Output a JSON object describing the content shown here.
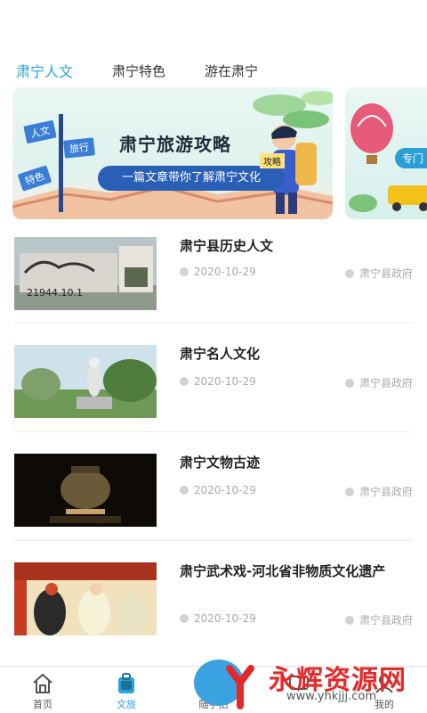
{
  "tabs": [
    {
      "label": "肃宁人文",
      "active": true
    },
    {
      "label": "肃宁特色",
      "active": false
    },
    {
      "label": "游在肃宁",
      "active": false
    }
  ],
  "banner": {
    "title": "肃宁旅游攻略",
    "subtitle": "一篇文章带你了解肃宁文化",
    "signs": [
      "人文",
      "旅行",
      "特色"
    ],
    "tag": "攻略"
  },
  "banner2": {
    "tag": "专门"
  },
  "articles": [
    {
      "title": "肃宁县历史人文",
      "date": "2020-10-29",
      "source": "肃宁县政府",
      "thumb_text": "21944.10.1"
    },
    {
      "title": "肃宁名人文化",
      "date": "2020-10-29",
      "source": "肃宁县政府"
    },
    {
      "title": "肃宁文物古迹",
      "date": "2020-10-29",
      "source": "肃宁县政府"
    },
    {
      "title": "肃宁武术戏-河北省非物质文化遗产",
      "date": "2020-10-29",
      "source": "肃宁县政府"
    }
  ],
  "tabbar": [
    {
      "label": "首页",
      "icon": "home-icon",
      "active": false
    },
    {
      "label": "文旅",
      "icon": "bag-icon",
      "active": true
    },
    {
      "label": "随手拍",
      "icon": "camera-icon",
      "active": false
    },
    {
      "label": "",
      "icon": "message-icon",
      "active": false
    },
    {
      "label": "我的",
      "icon": "user-icon",
      "active": false
    }
  ],
  "watermark": {
    "text": "永辉资源网",
    "url": "www.yhkjjj.com"
  },
  "colors": {
    "accent": "#2aa3d6",
    "banner_sub_bg": "#2a5fb8",
    "watermark": "#e32a2a"
  }
}
